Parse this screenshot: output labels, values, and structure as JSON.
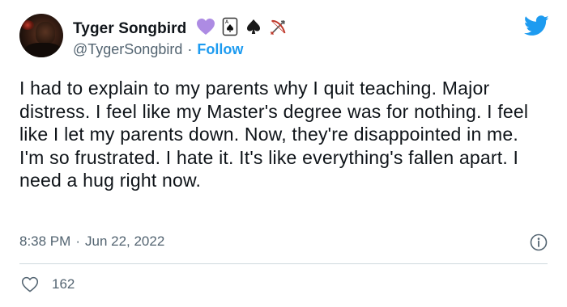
{
  "author": {
    "display_name": "Tyger Songbird",
    "handle": "@TygerSongbird",
    "separator": "·",
    "follow_label": "Follow",
    "badges": [
      "purple-heart-icon",
      "playing-card-icon",
      "spade-icon",
      "bow-and-arrow-icon"
    ]
  },
  "tweet": {
    "text": "I had to explain to my parents why I quit teaching. Major distress. I feel like my Master's degree was for nothing. I feel like I let my parents down. Now, they're disappointed in me. I'm so frustrated. I hate it. It's like everything's fallen apart. I need a hug right now.",
    "time": "8:38 PM",
    "separator": "·",
    "date": "Jun 22, 2022"
  },
  "engagement": {
    "likes": "162"
  },
  "colors": {
    "accent": "#1d9bf0",
    "text": "#0f1419",
    "secondary_text": "#536471",
    "divider": "#cfd9de",
    "heart_emoji": "#ad8be3"
  }
}
